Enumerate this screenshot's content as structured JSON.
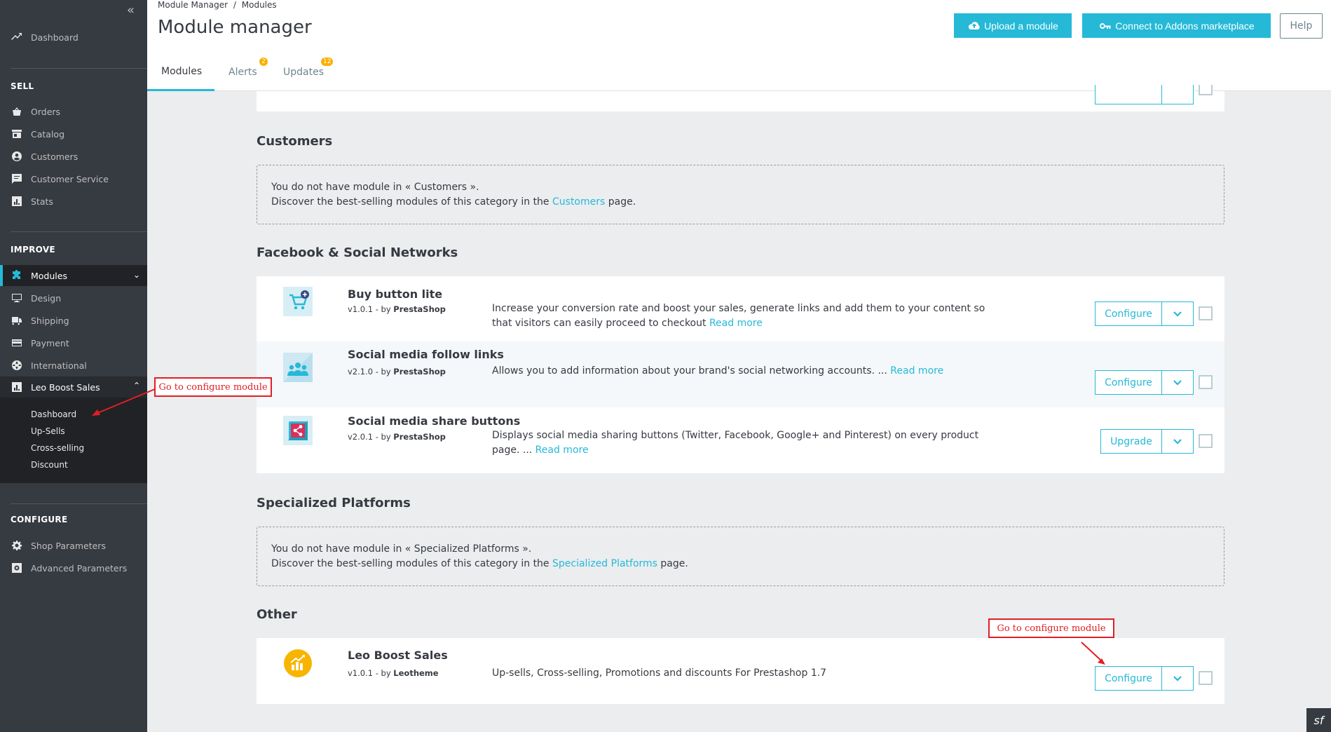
{
  "sidebar": {
    "collapse_icon": "double-chevron-left-icon",
    "dashboard": "Dashboard",
    "sell_heading": "SELL",
    "sell_items": [
      "Orders",
      "Catalog",
      "Customers",
      "Customer Service",
      "Stats"
    ],
    "improve_heading": "IMPROVE",
    "improve_items": [
      "Modules",
      "Design",
      "Shipping",
      "Payment",
      "International",
      "Leo Boost Sales"
    ],
    "submenu": [
      "Dashboard",
      "Up-Sells",
      "Cross-selling",
      "Discount"
    ],
    "configure_heading": "CONFIGURE",
    "configure_items": [
      "Shop Parameters",
      "Advanced Parameters"
    ]
  },
  "header": {
    "breadcrumb_1": "Module Manager",
    "breadcrumb_sep": "/",
    "breadcrumb_2": "Modules",
    "title": "Module manager",
    "upload_label": "Upload a module",
    "connect_label": "Connect to Addons marketplace",
    "help_label": "Help",
    "tabs": [
      {
        "label": "Modules",
        "badge": ""
      },
      {
        "label": "Alerts",
        "badge": "2"
      },
      {
        "label": "Updates",
        "badge": "12"
      }
    ]
  },
  "sections": {
    "customers": {
      "title": "Customers",
      "line1": "You do not have module in « Customers ».",
      "line2_prefix": "Discover the best-selling modules of this category in the ",
      "line2_link": "Customers",
      "line2_suffix": " page."
    },
    "facebook": {
      "title": "Facebook & Social Networks",
      "modules": [
        {
          "name": "Buy button lite",
          "version": "v1.0.1 - by ",
          "author": "PrestaShop",
          "desc": "Increase your conversion rate and boost your sales, generate links and add them to your content so that visitors can easily proceed to checkout ",
          "read_more": "Read more",
          "action": "Configure"
        },
        {
          "name": "Social media follow links",
          "version": "v2.1.0 - by ",
          "author": "PrestaShop",
          "desc": "Allows you to add information about your brand's social networking accounts. ... ",
          "read_more": "Read more",
          "action": "Configure"
        },
        {
          "name": "Social media share buttons",
          "version": "v2.0.1 - by ",
          "author": "PrestaShop",
          "desc": "Displays social media sharing buttons (Twitter, Facebook, Google+ and Pinterest) on every product page. ... ",
          "read_more": "Read more",
          "action": "Upgrade"
        }
      ]
    },
    "specialized": {
      "title": "Specialized Platforms",
      "line1": "You do not have module in « Specialized Platforms ».",
      "line2_prefix": "Discover the best-selling modules of this category in the ",
      "line2_link": "Specialized Platforms",
      "line2_suffix": " page."
    },
    "other": {
      "title": "Other",
      "modules": [
        {
          "name": "Leo Boost Sales",
          "version": "v1.0.1 - by ",
          "author": "Leotheme",
          "desc": "Up-sells, Cross-selling, Promotions and discounts For Prestashop 1.7",
          "action": "Configure"
        }
      ]
    }
  },
  "annotations": {
    "sidebar_note": "Go to configure module",
    "module_note": "Go to configure module"
  },
  "colors": {
    "accent": "#25b9d7",
    "sidebar_bg": "#363a41",
    "annotation": "#e21e25",
    "badge": "#fab000"
  }
}
